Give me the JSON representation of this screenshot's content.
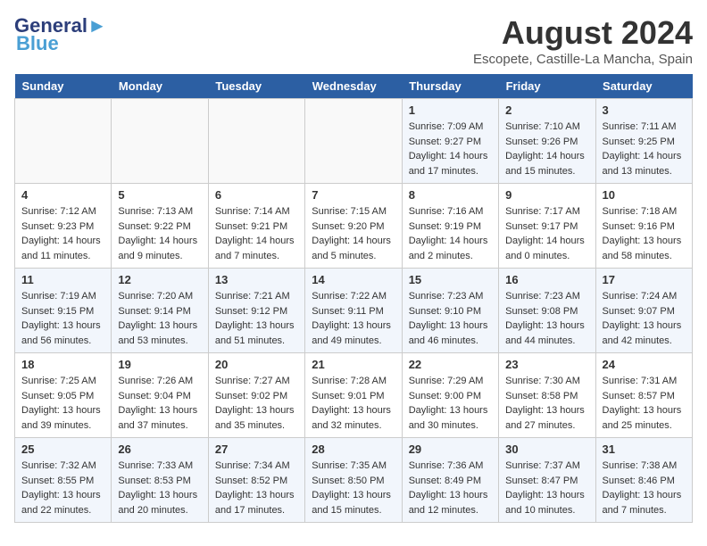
{
  "header": {
    "logo_general": "General",
    "logo_blue": "Blue",
    "month_year": "August 2024",
    "location": "Escopete, Castille-La Mancha, Spain"
  },
  "weekdays": [
    "Sunday",
    "Monday",
    "Tuesday",
    "Wednesday",
    "Thursday",
    "Friday",
    "Saturday"
  ],
  "weeks": [
    [
      {
        "day": "",
        "info": ""
      },
      {
        "day": "",
        "info": ""
      },
      {
        "day": "",
        "info": ""
      },
      {
        "day": "",
        "info": ""
      },
      {
        "day": "1",
        "info": "Sunrise: 7:09 AM\nSunset: 9:27 PM\nDaylight: 14 hours and 17 minutes."
      },
      {
        "day": "2",
        "info": "Sunrise: 7:10 AM\nSunset: 9:26 PM\nDaylight: 14 hours and 15 minutes."
      },
      {
        "day": "3",
        "info": "Sunrise: 7:11 AM\nSunset: 9:25 PM\nDaylight: 14 hours and 13 minutes."
      }
    ],
    [
      {
        "day": "4",
        "info": "Sunrise: 7:12 AM\nSunset: 9:23 PM\nDaylight: 14 hours and 11 minutes."
      },
      {
        "day": "5",
        "info": "Sunrise: 7:13 AM\nSunset: 9:22 PM\nDaylight: 14 hours and 9 minutes."
      },
      {
        "day": "6",
        "info": "Sunrise: 7:14 AM\nSunset: 9:21 PM\nDaylight: 14 hours and 7 minutes."
      },
      {
        "day": "7",
        "info": "Sunrise: 7:15 AM\nSunset: 9:20 PM\nDaylight: 14 hours and 5 minutes."
      },
      {
        "day": "8",
        "info": "Sunrise: 7:16 AM\nSunset: 9:19 PM\nDaylight: 14 hours and 2 minutes."
      },
      {
        "day": "9",
        "info": "Sunrise: 7:17 AM\nSunset: 9:17 PM\nDaylight: 14 hours and 0 minutes."
      },
      {
        "day": "10",
        "info": "Sunrise: 7:18 AM\nSunset: 9:16 PM\nDaylight: 13 hours and 58 minutes."
      }
    ],
    [
      {
        "day": "11",
        "info": "Sunrise: 7:19 AM\nSunset: 9:15 PM\nDaylight: 13 hours and 56 minutes."
      },
      {
        "day": "12",
        "info": "Sunrise: 7:20 AM\nSunset: 9:14 PM\nDaylight: 13 hours and 53 minutes."
      },
      {
        "day": "13",
        "info": "Sunrise: 7:21 AM\nSunset: 9:12 PM\nDaylight: 13 hours and 51 minutes."
      },
      {
        "day": "14",
        "info": "Sunrise: 7:22 AM\nSunset: 9:11 PM\nDaylight: 13 hours and 49 minutes."
      },
      {
        "day": "15",
        "info": "Sunrise: 7:23 AM\nSunset: 9:10 PM\nDaylight: 13 hours and 46 minutes."
      },
      {
        "day": "16",
        "info": "Sunrise: 7:23 AM\nSunset: 9:08 PM\nDaylight: 13 hours and 44 minutes."
      },
      {
        "day": "17",
        "info": "Sunrise: 7:24 AM\nSunset: 9:07 PM\nDaylight: 13 hours and 42 minutes."
      }
    ],
    [
      {
        "day": "18",
        "info": "Sunrise: 7:25 AM\nSunset: 9:05 PM\nDaylight: 13 hours and 39 minutes."
      },
      {
        "day": "19",
        "info": "Sunrise: 7:26 AM\nSunset: 9:04 PM\nDaylight: 13 hours and 37 minutes."
      },
      {
        "day": "20",
        "info": "Sunrise: 7:27 AM\nSunset: 9:02 PM\nDaylight: 13 hours and 35 minutes."
      },
      {
        "day": "21",
        "info": "Sunrise: 7:28 AM\nSunset: 9:01 PM\nDaylight: 13 hours and 32 minutes."
      },
      {
        "day": "22",
        "info": "Sunrise: 7:29 AM\nSunset: 9:00 PM\nDaylight: 13 hours and 30 minutes."
      },
      {
        "day": "23",
        "info": "Sunrise: 7:30 AM\nSunset: 8:58 PM\nDaylight: 13 hours and 27 minutes."
      },
      {
        "day": "24",
        "info": "Sunrise: 7:31 AM\nSunset: 8:57 PM\nDaylight: 13 hours and 25 minutes."
      }
    ],
    [
      {
        "day": "25",
        "info": "Sunrise: 7:32 AM\nSunset: 8:55 PM\nDaylight: 13 hours and 22 minutes."
      },
      {
        "day": "26",
        "info": "Sunrise: 7:33 AM\nSunset: 8:53 PM\nDaylight: 13 hours and 20 minutes."
      },
      {
        "day": "27",
        "info": "Sunrise: 7:34 AM\nSunset: 8:52 PM\nDaylight: 13 hours and 17 minutes."
      },
      {
        "day": "28",
        "info": "Sunrise: 7:35 AM\nSunset: 8:50 PM\nDaylight: 13 hours and 15 minutes."
      },
      {
        "day": "29",
        "info": "Sunrise: 7:36 AM\nSunset: 8:49 PM\nDaylight: 13 hours and 12 minutes."
      },
      {
        "day": "30",
        "info": "Sunrise: 7:37 AM\nSunset: 8:47 PM\nDaylight: 13 hours and 10 minutes."
      },
      {
        "day": "31",
        "info": "Sunrise: 7:38 AM\nSunset: 8:46 PM\nDaylight: 13 hours and 7 minutes."
      }
    ]
  ]
}
